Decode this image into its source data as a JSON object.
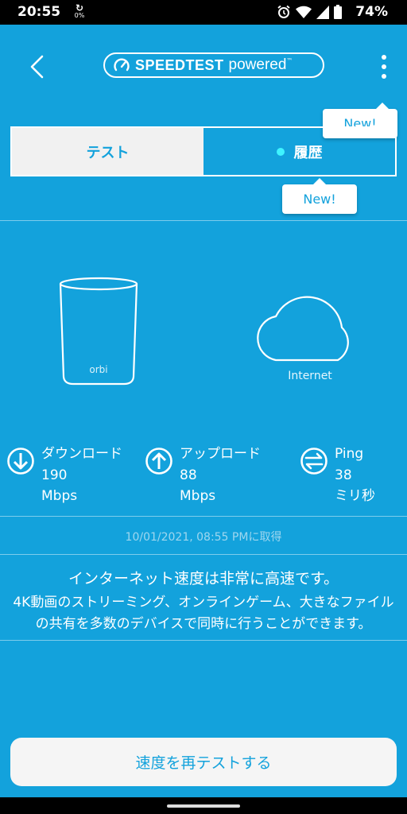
{
  "status_bar": {
    "time": "20:55",
    "data_saver_glyph": "↻",
    "data_saver_value": "0%",
    "icons": [
      "alarm-icon",
      "wifi-icon",
      "signal-icon",
      "battery-icon"
    ],
    "battery": "74%"
  },
  "header": {
    "brand_main": "SPEEDTEST",
    "brand_sub": "powered",
    "brand_tm": "™",
    "tooltip_menu": "New!"
  },
  "tabs": {
    "test_label": "テスト",
    "history_label": "履歴",
    "history_tooltip": "New!"
  },
  "diagram": {
    "router_brand": "orbi",
    "cloud_label": "Internet"
  },
  "metrics": {
    "download": {
      "label": "ダウンロード",
      "value": "190",
      "unit": "Mbps"
    },
    "upload": {
      "label": "アップロード",
      "value": "88",
      "unit": "Mbps"
    },
    "ping": {
      "label": "Ping",
      "value": "38",
      "unit": "ミリ秒"
    }
  },
  "timestamp": "10/01/2021, 08:55 PMに取得",
  "summary": {
    "headline": "インターネット速度は非常に高速です。",
    "detail": "4K動画のストリーミング、オンラインゲーム、大きなファイルの共有を多数のデバイスで同時に行うことができます。"
  },
  "retest_label": "速度を再テストする",
  "colors": {
    "background": "#13a2dc",
    "button_bg": "#f5f5f5",
    "status_dot": "#3ff4ff"
  }
}
